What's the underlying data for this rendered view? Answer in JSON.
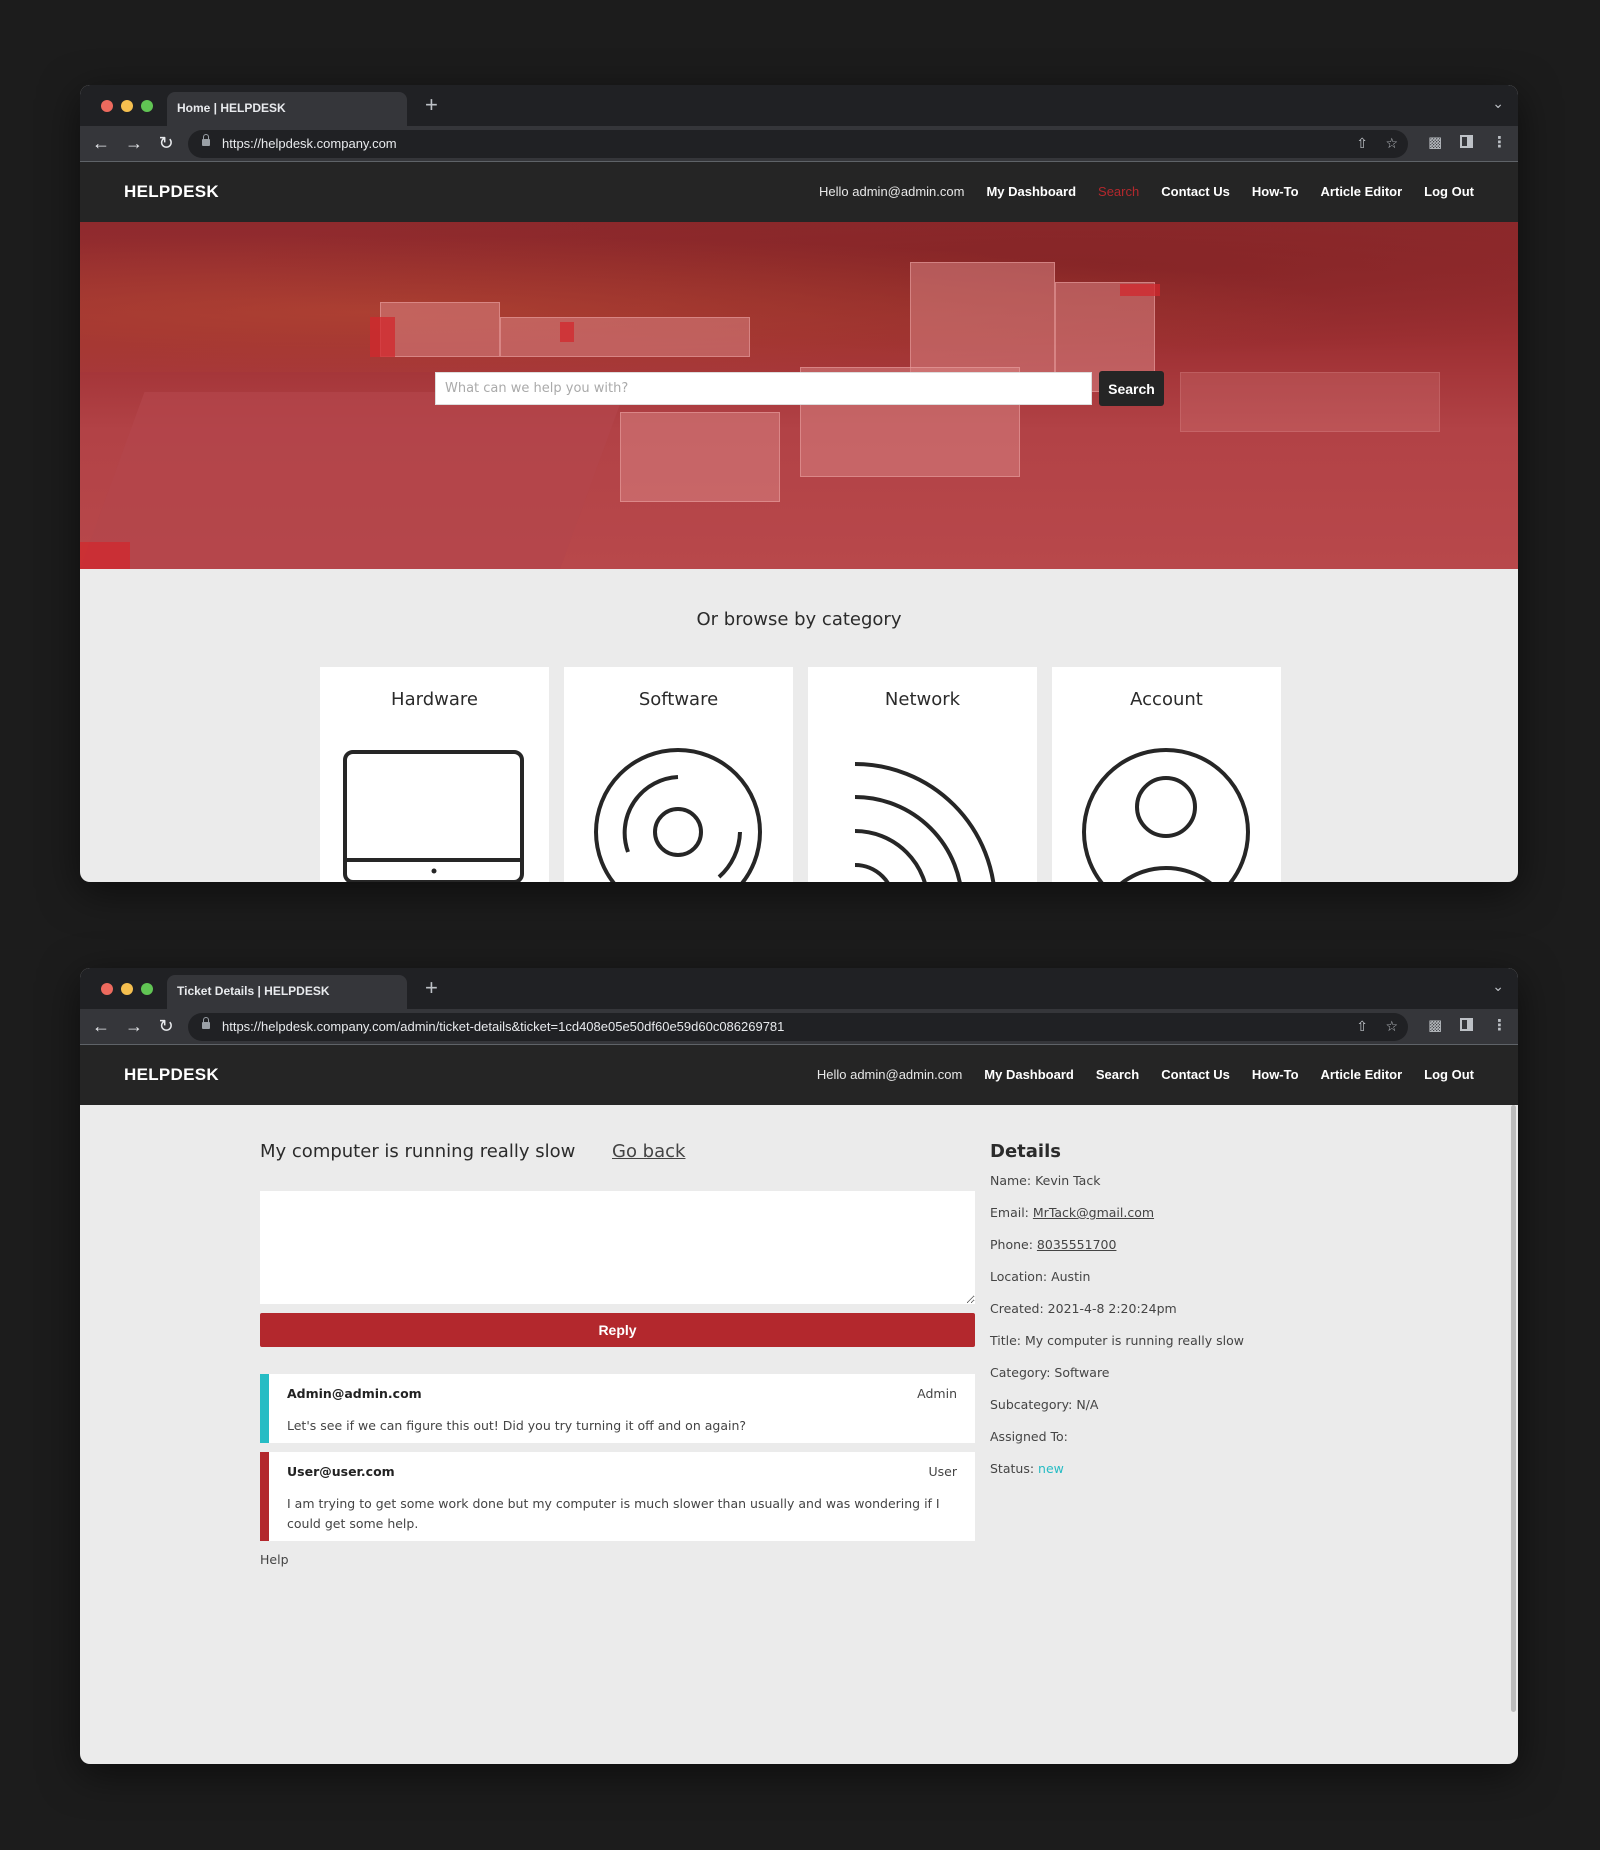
{
  "window1": {
    "tab_title": "Home | HELPDESK",
    "url": "https://helpdesk.company.com",
    "nav": {
      "brand": "HELPDESK",
      "greeting": "Hello admin@admin.com",
      "links": [
        "My Dashboard",
        "Search",
        "Contact Us",
        "How-To",
        "Article Editor",
        "Log Out"
      ],
      "active_link": "Search"
    },
    "hero": {
      "search_placeholder": "What can we help you with?",
      "search_value": "",
      "search_button": "Search"
    },
    "browse": {
      "title": "Or browse by category",
      "categories": [
        {
          "label": "Hardware",
          "icon": "laptop-icon"
        },
        {
          "label": "Software",
          "icon": "disc-icon"
        },
        {
          "label": "Network",
          "icon": "wifi-signal-icon"
        },
        {
          "label": "Account",
          "icon": "user-circle-icon"
        }
      ]
    }
  },
  "window2": {
    "tab_title": "Ticket Details | HELPDESK",
    "url": "https://helpdesk.company.com/admin/ticket-details&ticket=1cd408e05e50df60e59d60c086269781",
    "nav": {
      "brand": "HELPDESK",
      "greeting": "Hello admin@admin.com",
      "links": [
        "My Dashboard",
        "Search",
        "Contact Us",
        "How-To",
        "Article Editor",
        "Log Out"
      ]
    },
    "ticket": {
      "title": "My computer is running really slow",
      "go_back": "Go back",
      "reply_value": "",
      "reply_button": "Reply",
      "messages": [
        {
          "author": "Admin@admin.com",
          "role": "Admin",
          "body": "Let's see if we can figure this out! Did you try turning it off and on again?",
          "accent": "#26bcc4"
        },
        {
          "author": "User@user.com",
          "role": "User",
          "body": "I am trying to get some work done but my computer is much slower than usually and was wondering if I could get some help.",
          "accent": "#b3282d"
        }
      ],
      "help_label": "Help"
    },
    "details": {
      "heading": "Details",
      "name_label": "Name:",
      "name": "Kevin Tack",
      "email_label": "Email:",
      "email": "MrTack@gmail.com",
      "phone_label": "Phone:",
      "phone": "8035551700",
      "location_label": "Location:",
      "location": "Austin",
      "created_label": "Created:",
      "created": "2021-4-8 2:20:24pm",
      "title_label": "Title:",
      "title": "My computer is running really slow",
      "category_label": "Category:",
      "category": "Software",
      "subcategory_label": "Subcategory:",
      "subcategory": "N/A",
      "assigned_label": "Assigned To:",
      "assigned": "",
      "status_label": "Status:",
      "status": "new"
    }
  },
  "colors": {
    "brand_red": "#b3282d",
    "accent_teal": "#26bcc4",
    "nav_bg": "#252525",
    "page_bg": "#ebebeb"
  }
}
